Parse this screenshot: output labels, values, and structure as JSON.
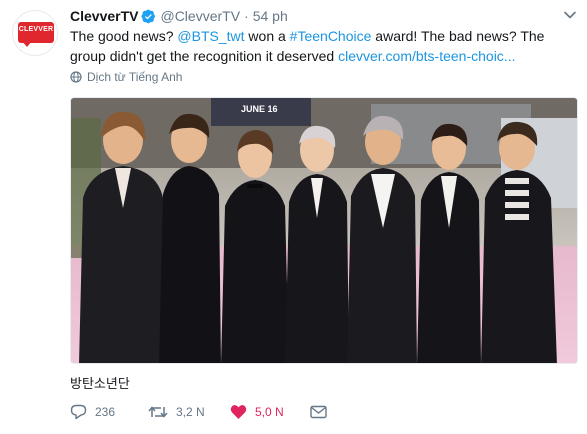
{
  "tweet": {
    "author": {
      "display_name": "ClevverTV",
      "handle": "@ClevverTV",
      "verified": true,
      "avatar_logo_text": "CLEVVER"
    },
    "separator": "·",
    "time": "54 ph",
    "text_parts": {
      "p1": "The good news? ",
      "mention": "@BTS_twt",
      "p2": " won a ",
      "hashtag": "#TeenChoice",
      "p3": " award! The bad news? The group didn't get the recognition it deserved ",
      "link": "clevver.com/bts-teen-choic..."
    },
    "translate_label": "Dịch từ Tiếng Anh",
    "photo_alt_caption": "방탄소년단",
    "photo_banner_text": "JUNE 16",
    "actions": {
      "replies": "236",
      "retweets": "3,2 N",
      "likes": "5,0 N"
    }
  },
  "colors": {
    "link": "#1b95e0",
    "meta": "#657786",
    "like": "#e0245e",
    "brand_red": "#e0272e",
    "verified_blue": "#1da1f2"
  },
  "icons": {
    "verified": "verified-badge-icon",
    "globe": "globe-icon",
    "caret": "chevron-down-icon",
    "reply": "reply-icon",
    "retweet": "retweet-icon",
    "like": "heart-icon",
    "dm": "envelope-icon"
  }
}
